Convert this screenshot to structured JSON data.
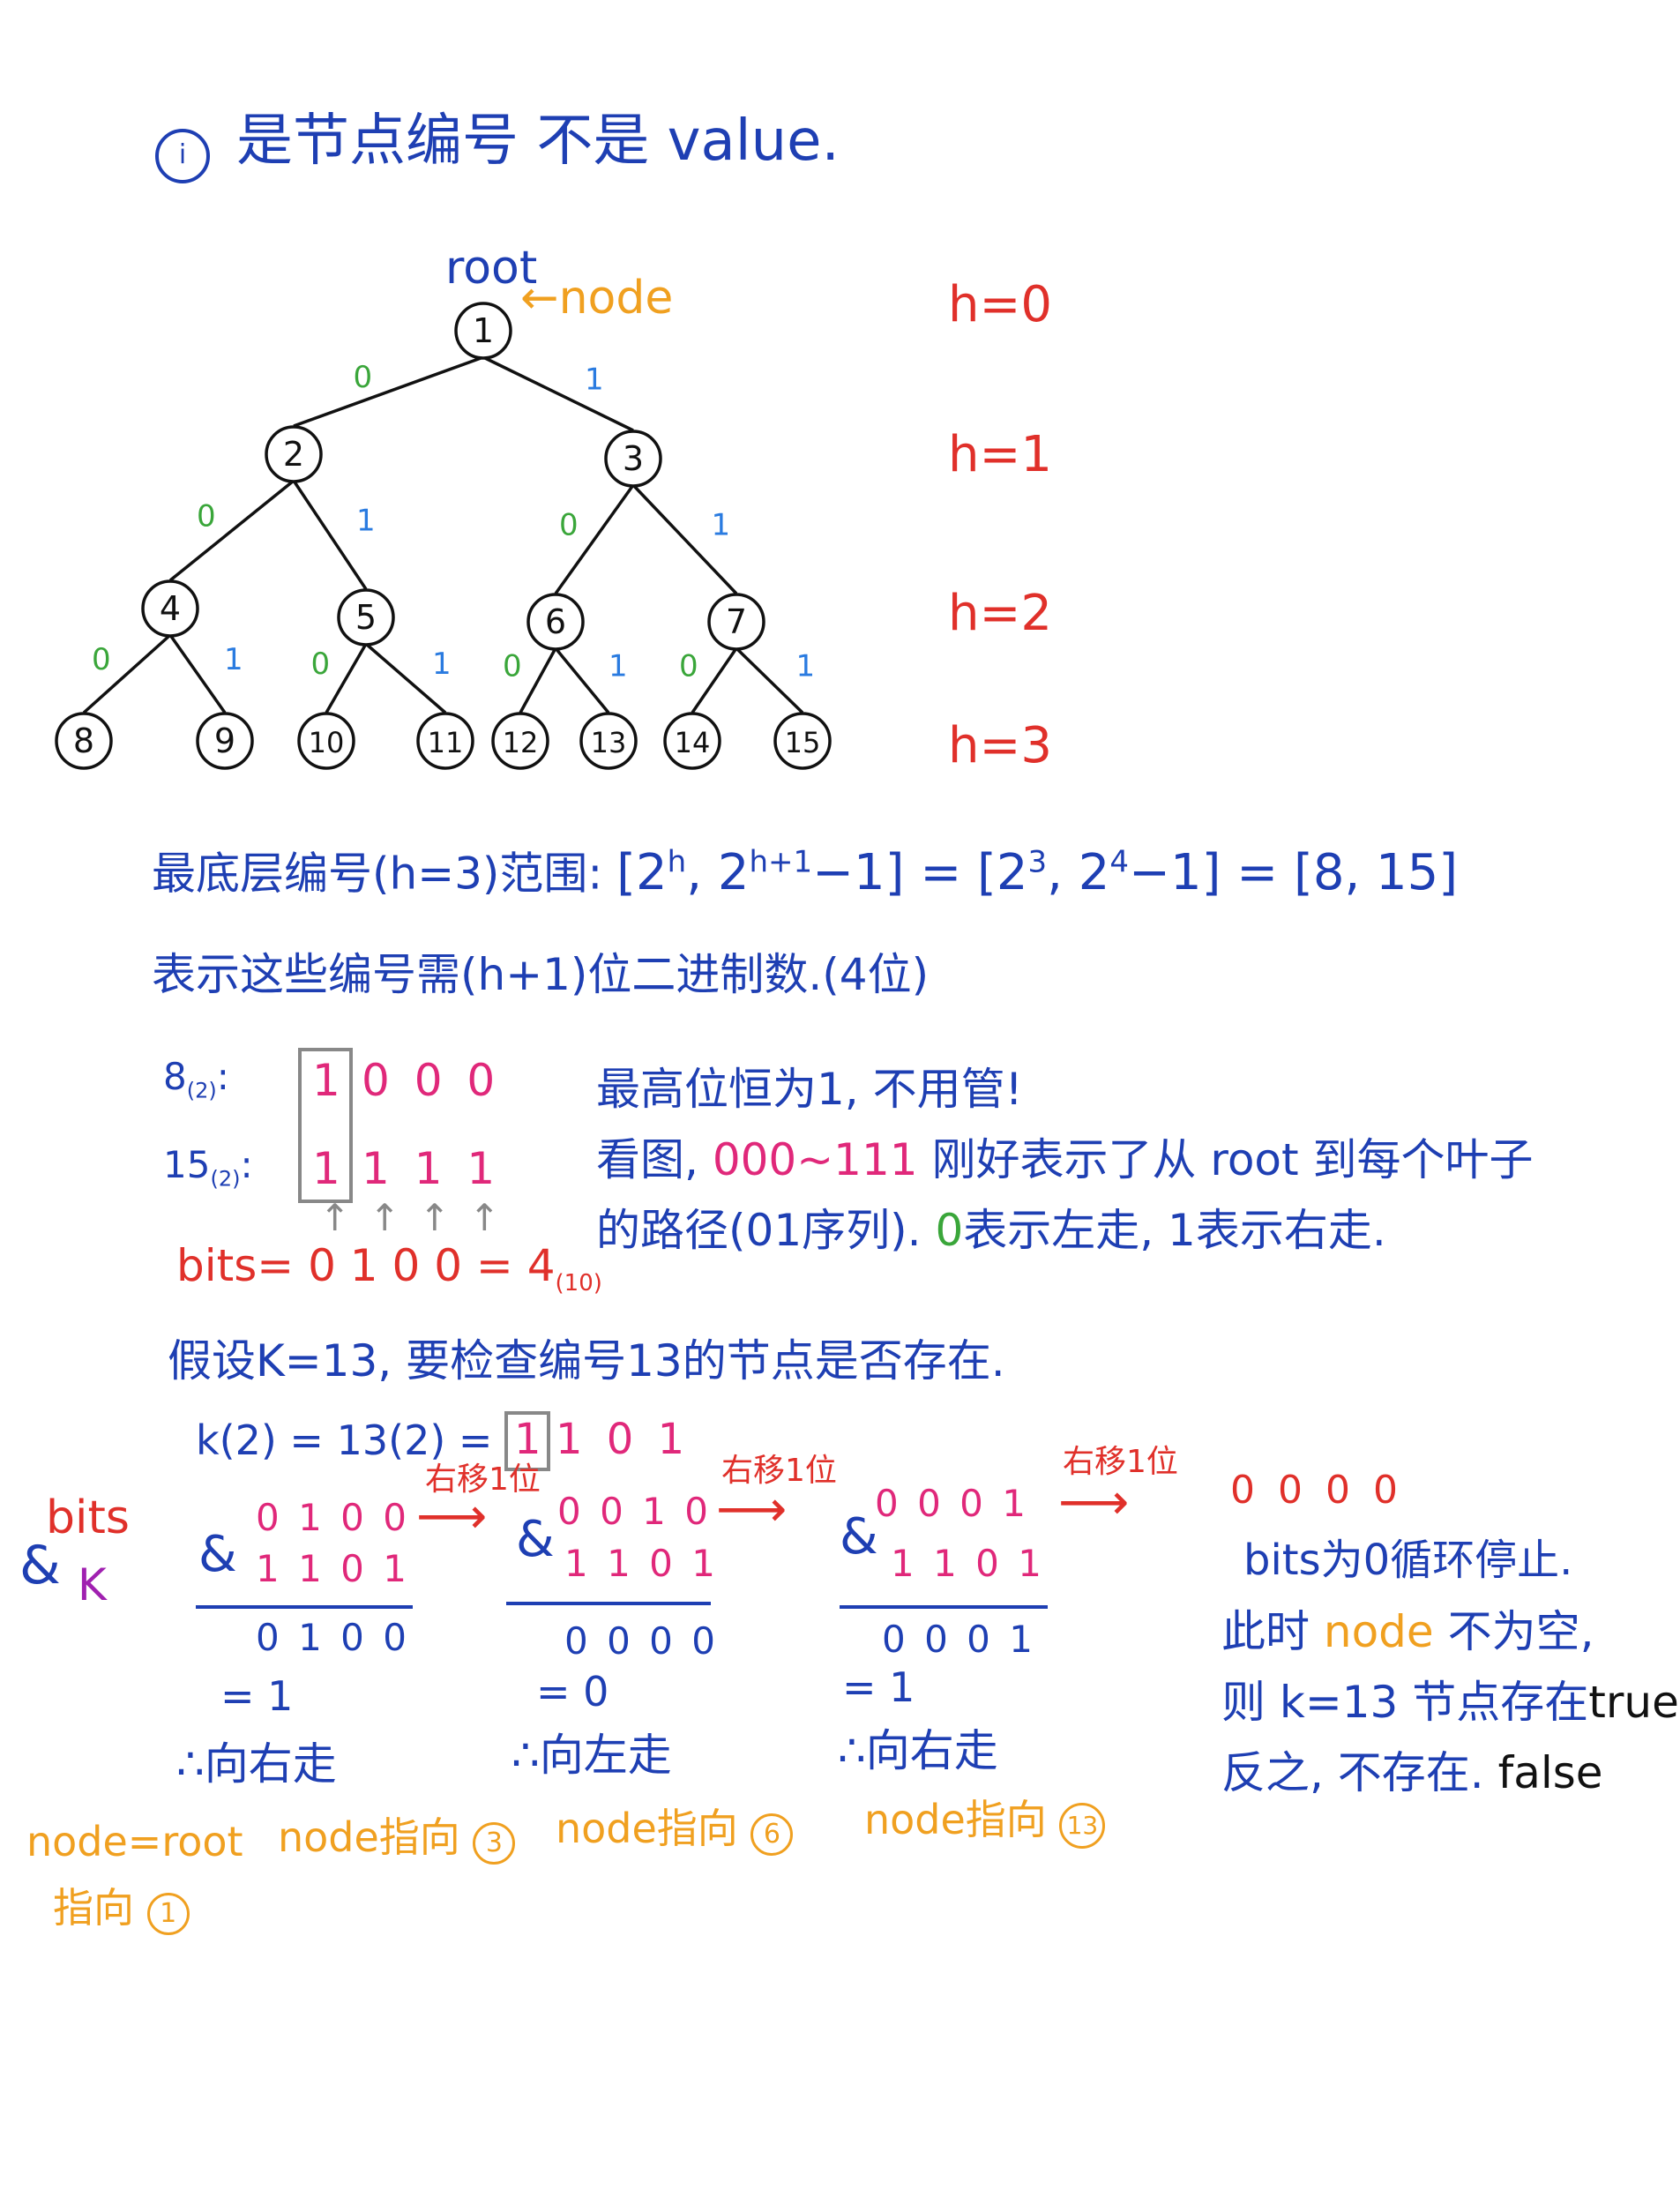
{
  "heading": {
    "circle_mark": "i",
    "text": "是节点编号 不是 value."
  },
  "tree": {
    "root_label": "root",
    "node_label": "node",
    "nodes": [
      "1",
      "2",
      "3",
      "4",
      "5",
      "6",
      "7",
      "8",
      "9",
      "10",
      "11",
      "12",
      "13",
      "14",
      "15"
    ],
    "edge_left": "0",
    "edge_right": "1"
  },
  "levels": [
    "h=0",
    "h=1",
    "h=2",
    "h=3"
  ],
  "range_line": {
    "text": "最底层编号(h=3)范围:",
    "formula_a": "[2",
    "sup_h": "h",
    "formula_b": ", 2",
    "sup_h1": "h+1",
    "formula_c": "−1] = [2",
    "sup_3": "3",
    "formula_d": ", 2",
    "sup_4": "4",
    "formula_e": "−1] = [8, 15]"
  },
  "bits_line": {
    "text": "表示这些编号需(h+1)位二进制数.(4位)"
  },
  "binary": {
    "row1_label": "8",
    "row1_sub": "(2)",
    "row1_first": "1",
    "row1_rest": "0 0 0",
    "row2_label": "15",
    "row2_sub": "(2)",
    "row2_first": "1",
    "row2_rest": "1 1 1",
    "arrows": "↑ ↑ ↑ ↑",
    "bits_label": "bits=",
    "bits_value": "0 1 0 0 = 4",
    "bits_sub": "(10)"
  },
  "notes": {
    "line1": "最高位恒为1, 不用管!",
    "line2a": "看图,",
    "line2b": "000~111",
    "line2c": "刚好表示了从 root 到每个叶子",
    "line3a": "的路径(01序列).",
    "line3b": "0",
    "line3c": "表示左走, 1表示右走."
  },
  "assume": "假设K=13, 要检查编号13的节点是否存在.",
  "k_binary": {
    "text": "k(2) = 13(2) =",
    "first": "1",
    "rest": "1 0 1"
  },
  "side_label": {
    "amp": "&",
    "bits": "bits",
    "k": "K"
  },
  "shift_label": "右移1位",
  "steps": [
    {
      "amp": "&",
      "top": "0 1 0 0",
      "bottom": "1 1 0 1",
      "result": "0 1 0 0",
      "eq": "= 1",
      "dir": "∴向右走",
      "node_text": "node指向",
      "node_num": "3"
    },
    {
      "amp": "&",
      "top": "0 0 1 0",
      "bottom": "1 1 0 1",
      "result": "0 0 0 0",
      "eq": "= 0",
      "dir": "∴向左走",
      "node_text": "node指向",
      "node_num": "6"
    },
    {
      "amp": "&",
      "top": "0 0 0 1",
      "bottom": "1 1 0 1",
      "result": "0 0 0 1",
      "eq": "= 1",
      "dir": "∴向右走",
      "node_text": "node指向",
      "node_num": "13"
    }
  ],
  "final_bits": "0 0 0 0",
  "init": {
    "line1": "node=root",
    "line2": "指向",
    "num": "1"
  },
  "conclusion": {
    "line1": "bits为0循环停止.",
    "line2a": "此时",
    "line2b": "node",
    "line2c": "不为空,",
    "line3a": "则 k=13 节点存在",
    "line3b": "true",
    "line4a": "反之, 不存在.",
    "line4b": "false"
  },
  "colors": {
    "blue": "#1e3fb3",
    "red": "#e0302a",
    "orange": "#f0a020",
    "green": "#3aa63a",
    "light_blue": "#2a7be0",
    "magenta": "#e0287a",
    "purple": "#a020b0"
  }
}
